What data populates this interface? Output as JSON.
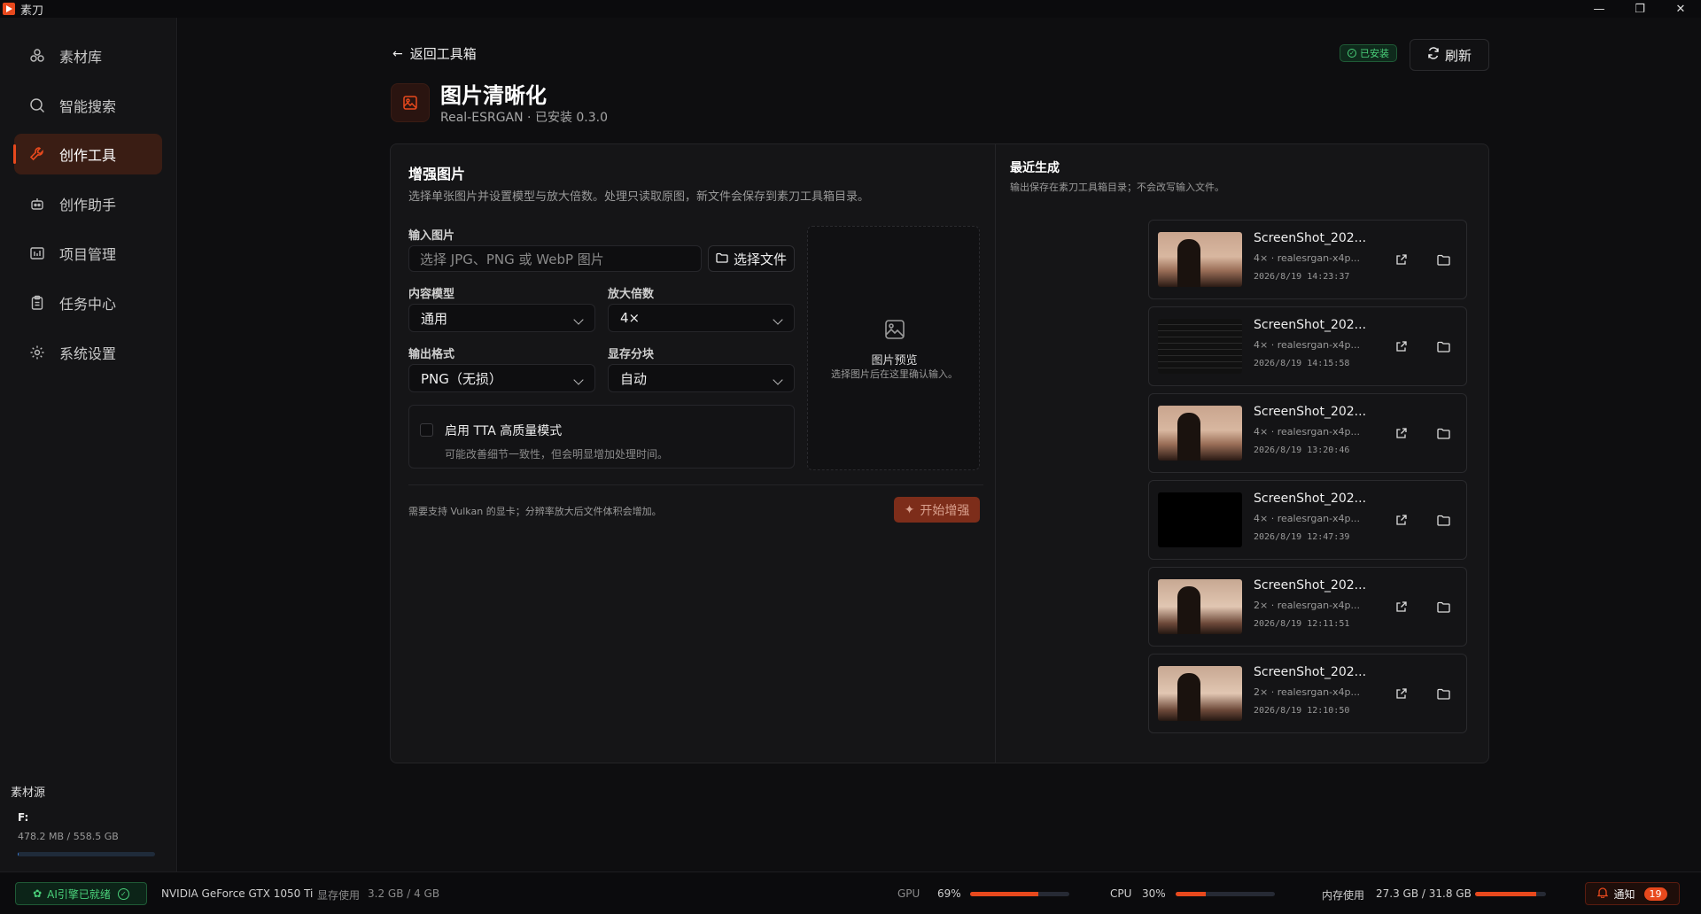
{
  "app": {
    "title": "素刀"
  },
  "window_controls": {
    "minimize": "—",
    "restore": "❐",
    "close": "✕"
  },
  "sidebar": {
    "items": [
      {
        "label": "素材库",
        "icon": "assets-icon",
        "active": false
      },
      {
        "label": "智能搜索",
        "icon": "search-icon",
        "active": false
      },
      {
        "label": "创作工具",
        "icon": "wrench-icon",
        "active": true
      },
      {
        "label": "创作助手",
        "icon": "robot-icon",
        "active": false
      },
      {
        "label": "项目管理",
        "icon": "project-icon",
        "active": false
      },
      {
        "label": "任务中心",
        "icon": "clipboard-icon",
        "active": false
      },
      {
        "label": "系统设置",
        "icon": "gear-icon",
        "active": false
      }
    ],
    "source_title": "素材源",
    "drive": {
      "name": "F:",
      "usage": "478.2 MB / 558.5 GB",
      "used_fraction": 0.0009
    }
  },
  "header": {
    "back_label": "返回工具箱",
    "installed_badge": "已安装",
    "refresh_label": "刷新",
    "tool_title": "图片清晰化",
    "tool_sub": "Real-ESRGAN · 已安装 0.3.0"
  },
  "enhance": {
    "title": "增强图片",
    "desc": "选择单张图片并设置模型与放大倍数。处理只读取原图，新文件会保存到素刀工具箱目录。",
    "input_label": "输入图片",
    "input_placeholder": "选择 JPG、PNG 或 WebP 图片",
    "choose_file": "选择文件",
    "model_label": "内容模型",
    "model_value": "通用",
    "scale_label": "放大倍数",
    "scale_value": "4×",
    "format_label": "输出格式",
    "format_value": "PNG（无损）",
    "tile_label": "显存分块",
    "tile_value": "自动",
    "tta_label": "启用 TTA 高质量模式",
    "tta_desc": "可能改善细节一致性，但会明显增加处理时间。",
    "tta_checked": false,
    "preview_title": "图片预览",
    "preview_desc": "选择图片后在这里确认输入。",
    "footer_note": "需要支持 Vulkan 的显卡；分辨率放大后文件体积会增加。",
    "start_label": "开始增强"
  },
  "recent": {
    "title": "最近生成",
    "desc": "输出保存在素刀工具箱目录；不会改写输入文件。",
    "items": [
      {
        "name": "ScreenShot_202...",
        "meta": "4× · realesrgan-x4p...",
        "time": "2026/8/19 14:23:37",
        "thumb": "sunset"
      },
      {
        "name": "ScreenShot_202...",
        "meta": "4× · realesrgan-x4p...",
        "time": "2026/8/19 14:15:58",
        "thumb": "screen"
      },
      {
        "name": "ScreenShot_202...",
        "meta": "4× · realesrgan-x4p...",
        "time": "2026/8/19 13:20:46",
        "thumb": "sunset"
      },
      {
        "name": "ScreenShot_202...",
        "meta": "4× · realesrgan-x4p...",
        "time": "2026/8/19 12:47:39",
        "thumb": "black"
      },
      {
        "name": "ScreenShot_202...",
        "meta": "2× · realesrgan-x4p...",
        "time": "2026/8/19 12:11:51",
        "thumb": "pixel"
      },
      {
        "name": "ScreenShot_202...",
        "meta": "2× · realesrgan-x4p...",
        "time": "2026/8/19 12:10:50",
        "thumb": "pixel"
      }
    ]
  },
  "status": {
    "ai_badge": "AI引擎已就绪",
    "gpu_name": "NVIDIA GeForce GTX 1050 Ti",
    "vram_label": "显存使用",
    "vram_value": "3.2 GB / 4 GB",
    "gpu_label": "GPU",
    "gpu_value": "69%",
    "gpu_fraction": 0.69,
    "cpu_label": "CPU",
    "cpu_value": "30%",
    "cpu_fraction": 0.3,
    "mem_label": "内存使用",
    "mem_value": "27.3 GB / 31.8 GB",
    "mem_fraction": 0.86,
    "notify_label": "通知",
    "notify_count": "19"
  },
  "colors": {
    "accent": "#e8491d",
    "success": "#4ad07a",
    "background": "#0e0e10"
  }
}
